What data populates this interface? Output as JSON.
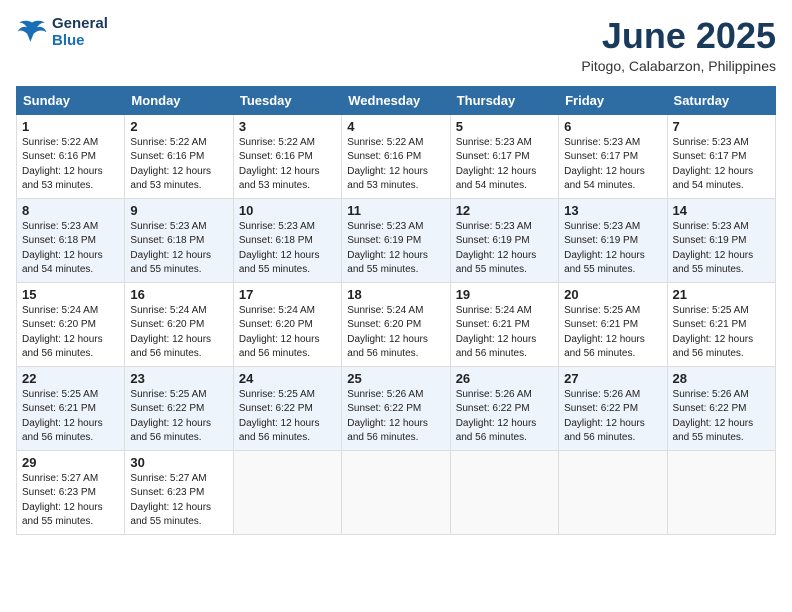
{
  "header": {
    "logo_line1": "General",
    "logo_line2": "Blue",
    "month": "June 2025",
    "location": "Pitogo, Calabarzon, Philippines"
  },
  "columns": [
    "Sunday",
    "Monday",
    "Tuesday",
    "Wednesday",
    "Thursday",
    "Friday",
    "Saturday"
  ],
  "weeks": [
    [
      {
        "day": "1",
        "sunrise": "5:22 AM",
        "sunset": "6:16 PM",
        "daylight": "12 hours and 53 minutes."
      },
      {
        "day": "2",
        "sunrise": "5:22 AM",
        "sunset": "6:16 PM",
        "daylight": "12 hours and 53 minutes."
      },
      {
        "day": "3",
        "sunrise": "5:22 AM",
        "sunset": "6:16 PM",
        "daylight": "12 hours and 53 minutes."
      },
      {
        "day": "4",
        "sunrise": "5:22 AM",
        "sunset": "6:16 PM",
        "daylight": "12 hours and 53 minutes."
      },
      {
        "day": "5",
        "sunrise": "5:23 AM",
        "sunset": "6:17 PM",
        "daylight": "12 hours and 54 minutes."
      },
      {
        "day": "6",
        "sunrise": "5:23 AM",
        "sunset": "6:17 PM",
        "daylight": "12 hours and 54 minutes."
      },
      {
        "day": "7",
        "sunrise": "5:23 AM",
        "sunset": "6:17 PM",
        "daylight": "12 hours and 54 minutes."
      }
    ],
    [
      {
        "day": "8",
        "sunrise": "5:23 AM",
        "sunset": "6:18 PM",
        "daylight": "12 hours and 54 minutes."
      },
      {
        "day": "9",
        "sunrise": "5:23 AM",
        "sunset": "6:18 PM",
        "daylight": "12 hours and 55 minutes."
      },
      {
        "day": "10",
        "sunrise": "5:23 AM",
        "sunset": "6:18 PM",
        "daylight": "12 hours and 55 minutes."
      },
      {
        "day": "11",
        "sunrise": "5:23 AM",
        "sunset": "6:19 PM",
        "daylight": "12 hours and 55 minutes."
      },
      {
        "day": "12",
        "sunrise": "5:23 AM",
        "sunset": "6:19 PM",
        "daylight": "12 hours and 55 minutes."
      },
      {
        "day": "13",
        "sunrise": "5:23 AM",
        "sunset": "6:19 PM",
        "daylight": "12 hours and 55 minutes."
      },
      {
        "day": "14",
        "sunrise": "5:23 AM",
        "sunset": "6:19 PM",
        "daylight": "12 hours and 55 minutes."
      }
    ],
    [
      {
        "day": "15",
        "sunrise": "5:24 AM",
        "sunset": "6:20 PM",
        "daylight": "12 hours and 56 minutes."
      },
      {
        "day": "16",
        "sunrise": "5:24 AM",
        "sunset": "6:20 PM",
        "daylight": "12 hours and 56 minutes."
      },
      {
        "day": "17",
        "sunrise": "5:24 AM",
        "sunset": "6:20 PM",
        "daylight": "12 hours and 56 minutes."
      },
      {
        "day": "18",
        "sunrise": "5:24 AM",
        "sunset": "6:20 PM",
        "daylight": "12 hours and 56 minutes."
      },
      {
        "day": "19",
        "sunrise": "5:24 AM",
        "sunset": "6:21 PM",
        "daylight": "12 hours and 56 minutes."
      },
      {
        "day": "20",
        "sunrise": "5:25 AM",
        "sunset": "6:21 PM",
        "daylight": "12 hours and 56 minutes."
      },
      {
        "day": "21",
        "sunrise": "5:25 AM",
        "sunset": "6:21 PM",
        "daylight": "12 hours and 56 minutes."
      }
    ],
    [
      {
        "day": "22",
        "sunrise": "5:25 AM",
        "sunset": "6:21 PM",
        "daylight": "12 hours and 56 minutes."
      },
      {
        "day": "23",
        "sunrise": "5:25 AM",
        "sunset": "6:22 PM",
        "daylight": "12 hours and 56 minutes."
      },
      {
        "day": "24",
        "sunrise": "5:25 AM",
        "sunset": "6:22 PM",
        "daylight": "12 hours and 56 minutes."
      },
      {
        "day": "25",
        "sunrise": "5:26 AM",
        "sunset": "6:22 PM",
        "daylight": "12 hours and 56 minutes."
      },
      {
        "day": "26",
        "sunrise": "5:26 AM",
        "sunset": "6:22 PM",
        "daylight": "12 hours and 56 minutes."
      },
      {
        "day": "27",
        "sunrise": "5:26 AM",
        "sunset": "6:22 PM",
        "daylight": "12 hours and 56 minutes."
      },
      {
        "day": "28",
        "sunrise": "5:26 AM",
        "sunset": "6:22 PM",
        "daylight": "12 hours and 55 minutes."
      }
    ],
    [
      {
        "day": "29",
        "sunrise": "5:27 AM",
        "sunset": "6:23 PM",
        "daylight": "12 hours and 55 minutes."
      },
      {
        "day": "30",
        "sunrise": "5:27 AM",
        "sunset": "6:23 PM",
        "daylight": "12 hours and 55 minutes."
      },
      null,
      null,
      null,
      null,
      null
    ]
  ]
}
